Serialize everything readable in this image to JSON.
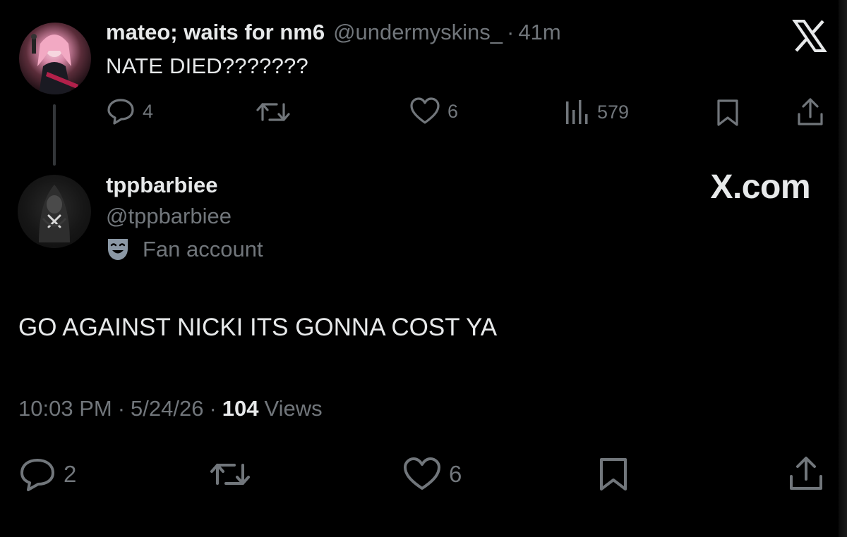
{
  "parent_tweet": {
    "display_name": "mateo; waits for nm6",
    "handle": "@undermyskins_",
    "separator": "·",
    "time_ago": "41m",
    "text": "NATE DIED???????",
    "avatar_icon": "user-avatar-performer-icon",
    "stats": {
      "replies": "4",
      "likes": "6",
      "views": "579"
    }
  },
  "brand": {
    "logo_icon": "x-logo-icon",
    "domain_label": "X.com"
  },
  "reply_tweet": {
    "display_name": "tppbarbiee",
    "handle": "@tppbarbiee",
    "badge_icon": "theater-mask-icon",
    "badge_label": "Fan account",
    "text": "GO AGAINST NICKI ITS GONNA COST YA",
    "meta": {
      "time": "10:03 PM",
      "separator": "·",
      "date": "5/24/26",
      "views_count": "104",
      "views_label": "Views"
    },
    "stats": {
      "replies": "2",
      "likes": "6"
    }
  },
  "colors": {
    "background": "#000000",
    "primary_text": "#e7e9ea",
    "secondary_text": "#71767b",
    "thread_line": "#333639",
    "badge_icon": "#8b98a5"
  }
}
